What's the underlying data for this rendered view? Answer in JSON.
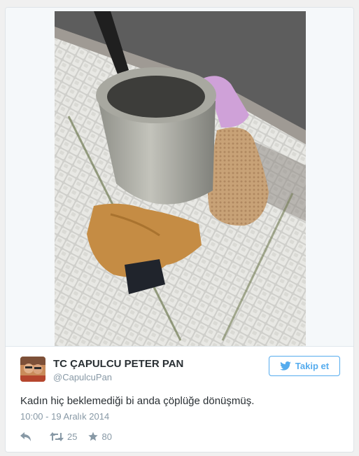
{
  "tweet": {
    "display_name": "TC ÇAPULCU PETER PAN",
    "handle": "@CapulcuPan",
    "follow_label": "Takip et",
    "text": "Kadın hiç beklemediği bi anda çöplüğe dönüşmüş.",
    "timestamp": "10:00 - 19 Aralık 2014",
    "retweet_count": "25",
    "favorite_count": "80"
  },
  "icons": {
    "follow": "twitter-bird-icon",
    "reply": "reply-icon",
    "retweet": "retweet-icon",
    "favorite": "star-icon"
  },
  "colors": {
    "accent": "#55acee",
    "text": "#292f33",
    "muted": "#8899a6",
    "border": "#e1e8ed"
  }
}
